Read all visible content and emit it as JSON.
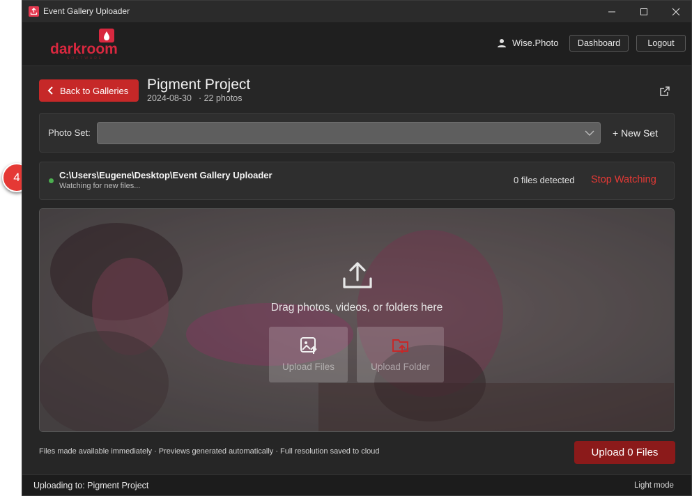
{
  "window": {
    "title": "Event Gallery Uploader"
  },
  "header": {
    "logo_text": "darkroom",
    "logo_sub": "SOFTWARE",
    "user_name": "Wise.Photo",
    "dashboard_label": "Dashboard",
    "logout_label": "Logout"
  },
  "gallery": {
    "back_label": "Back to Galleries",
    "title": "Pigment Project",
    "date": "2024-08-30",
    "photos": "· 22 photos"
  },
  "photo_set": {
    "label": "Photo Set:",
    "selected_value": "",
    "new_set_label": "+ New Set"
  },
  "watcher": {
    "path": "C:\\Users\\Eugene\\Desktop\\Event Gallery Uploader",
    "status": "Watching for new files...",
    "files_detected": "0 files detected",
    "stop_label": "Stop Watching"
  },
  "dropzone": {
    "prompt": "Drag photos, videos, or folders here",
    "upload_files_label": "Upload Files",
    "upload_folder_label": "Upload Folder"
  },
  "footer": {
    "note": "Files made available immediately · Previews generated automatically · Full resolution saved to cloud",
    "upload_button": "Upload 0 Files"
  },
  "statusbar": {
    "uploading_to": "Uploading to: Pigment Project",
    "light_mode": "Light mode"
  },
  "callout": {
    "number": "4"
  },
  "colors": {
    "accent_red": "#c62828",
    "status_green": "#4caf50",
    "stop_red": "#e53935"
  }
}
